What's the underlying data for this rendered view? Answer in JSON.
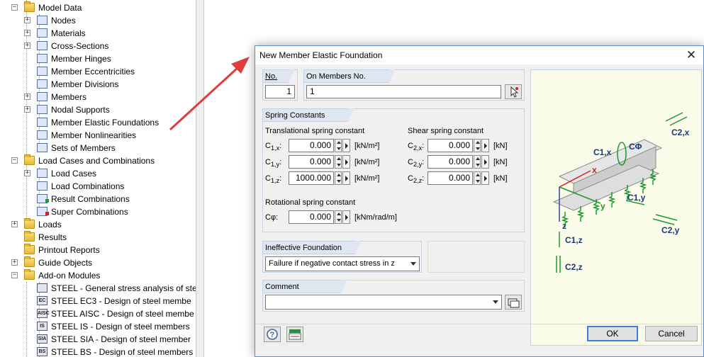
{
  "tree": {
    "items": [
      {
        "label": "Model Data",
        "icon": "folder-open-icon"
      },
      {
        "label": "Nodes",
        "icon": "nodes-icon"
      },
      {
        "label": "Materials",
        "icon": "materials-icon"
      },
      {
        "label": "Cross-Sections",
        "icon": "cross-sections-icon"
      },
      {
        "label": "Member Hinges",
        "icon": "member-hinges-icon"
      },
      {
        "label": "Member Eccentricities",
        "icon": "member-eccentricities-icon"
      },
      {
        "label": "Member Divisions",
        "icon": "member-divisions-icon"
      },
      {
        "label": "Members",
        "icon": "members-icon"
      },
      {
        "label": "Nodal Supports",
        "icon": "nodal-supports-icon"
      },
      {
        "label": "Member Elastic Foundations",
        "icon": "member-elastic-foundations-icon"
      },
      {
        "label": "Member Nonlinearities",
        "icon": "member-nonlinearities-icon"
      },
      {
        "label": "Sets of Members",
        "icon": "sets-of-members-icon"
      },
      {
        "label": "Load Cases and Combinations",
        "icon": "folder-open-icon"
      },
      {
        "label": "Load Cases",
        "icon": "load-cases-icon"
      },
      {
        "label": "Load Combinations",
        "icon": "load-combinations-icon"
      },
      {
        "label": "Result Combinations",
        "icon": "result-combinations-icon"
      },
      {
        "label": "Super Combinations",
        "icon": "super-combinations-icon"
      },
      {
        "label": "Loads",
        "icon": "folder-icon"
      },
      {
        "label": "Results",
        "icon": "folder-icon"
      },
      {
        "label": "Printout Reports",
        "icon": "folder-icon"
      },
      {
        "label": "Guide Objects",
        "icon": "folder-icon"
      },
      {
        "label": "Add-on Modules",
        "icon": "folder-open-icon"
      },
      {
        "label": "STEEL - General stress analysis of ste",
        "icon": "steel-module-icon"
      },
      {
        "label": "STEEL EC3 - Design of steel membe",
        "icon": "steel-ec3-icon",
        "badge": "EC"
      },
      {
        "label": "STEEL AISC - Design of steel membe",
        "icon": "steel-aisc-icon",
        "badge": "AISC"
      },
      {
        "label": "STEEL IS - Design of steel members",
        "icon": "steel-is-icon",
        "badge": "IS"
      },
      {
        "label": "STEEL SIA - Design of steel member",
        "icon": "steel-sia-icon",
        "badge": "SIA"
      },
      {
        "label": "STEEL BS - Design of steel members",
        "icon": "steel-bs-icon",
        "badge": "BS"
      }
    ]
  },
  "dialog": {
    "title": "New Member Elastic Foundation",
    "no": {
      "label": "No.",
      "value": "1"
    },
    "on_members": {
      "label": "On Members No.",
      "value": "1"
    },
    "spring_constants": {
      "header": "Spring Constants",
      "translational_title": "Translational spring constant",
      "shear_title": "Shear spring constant",
      "rotational_title": "Rotational spring constant",
      "c1x": {
        "sym": "C",
        "sub": "1,x",
        "colon": ":",
        "value": "0.000",
        "unit": "[kN/m²]"
      },
      "c1y": {
        "sym": "C",
        "sub": "1,y",
        "colon": ":",
        "value": "0.000",
        "unit": "[kN/m²]"
      },
      "c1z": {
        "sym": "C",
        "sub": "1,z",
        "colon": ":",
        "value": "1000.000",
        "unit": "[kN/m²]"
      },
      "c2x": {
        "sym": "C",
        "sub": "2,x",
        "colon": ":",
        "value": "0.000",
        "unit": "[kN]"
      },
      "c2y": {
        "sym": "C",
        "sub": "2,y",
        "colon": ":",
        "value": "0.000",
        "unit": "[kN]"
      },
      "c2z": {
        "sym": "C",
        "sub": "2,z",
        "colon": ":",
        "value": "0.000",
        "unit": "[kN]"
      },
      "cphi": {
        "label": "Cφ:",
        "value": "0.000",
        "unit": "[kNm/rad/m]"
      }
    },
    "ineffective": {
      "header": "Ineffective Foundation",
      "selected": "Failure if negative contact stress in z"
    },
    "comment": {
      "header": "Comment",
      "value": ""
    },
    "preview_labels": {
      "c2x": "C2,x",
      "c1x": "C1,x",
      "cphi": "CΦ",
      "x": "x",
      "y": "y",
      "z": "z",
      "c1y": "C1,y",
      "c2y": "C2,y",
      "c1z": "C1,z",
      "c2z": "C2,z"
    },
    "buttons": {
      "ok": "OK",
      "cancel": "Cancel"
    }
  }
}
